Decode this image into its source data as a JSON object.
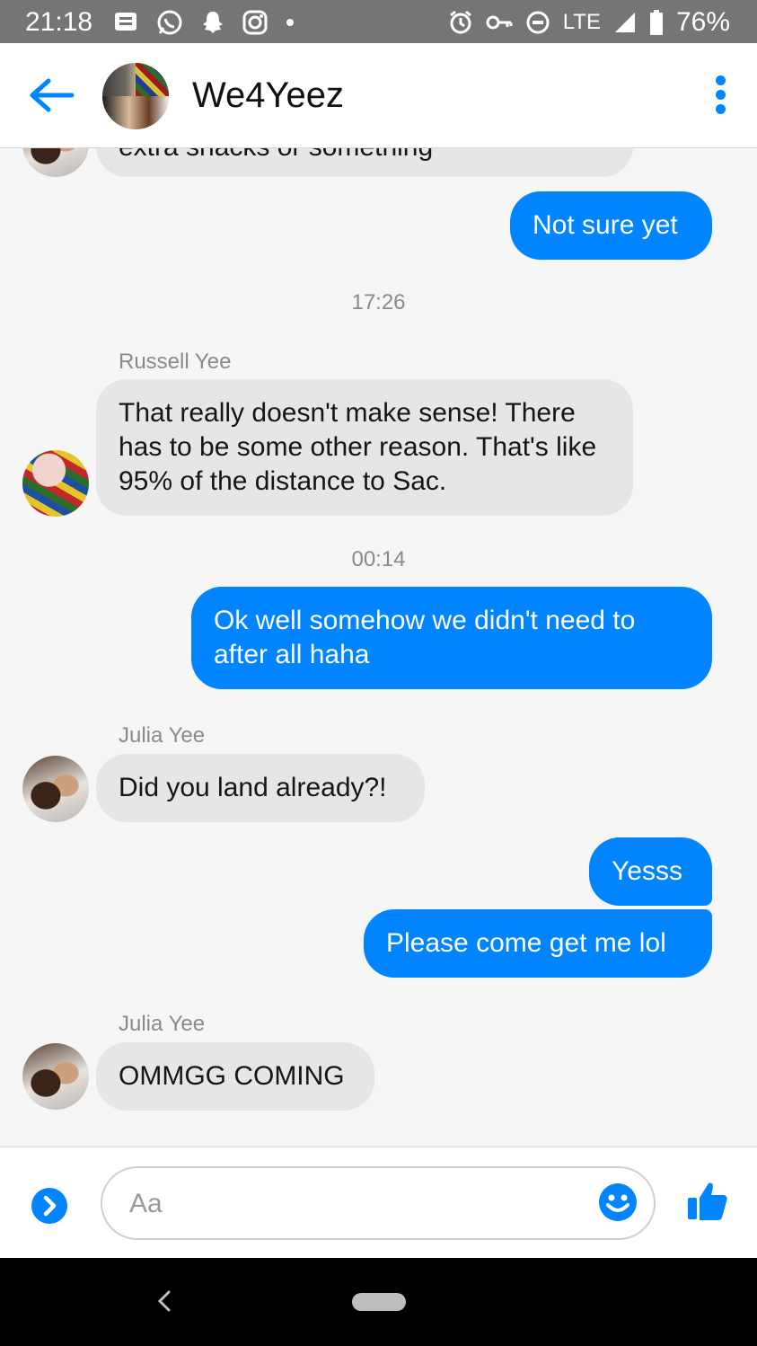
{
  "status_bar": {
    "time": "21:18",
    "network": "LTE",
    "battery": "76%"
  },
  "header": {
    "title": "We4Yeez"
  },
  "thread": {
    "partial_message": "extra snacks or something",
    "messages": [
      {
        "id": "m1",
        "text": "Not sure yet"
      },
      {
        "id": "ts1",
        "text": "17:26"
      },
      {
        "id": "s1",
        "text": "Russell Yee"
      },
      {
        "id": "m2",
        "text": "That really doesn't make sense! There has to be some other reason. That's like 95% of the distance to Sac."
      },
      {
        "id": "ts2",
        "text": "00:14"
      },
      {
        "id": "m3",
        "text": "Ok well somehow we didn't need to after all haha"
      },
      {
        "id": "s2",
        "text": "Julia Yee"
      },
      {
        "id": "m4",
        "text": "Did you land already?!"
      },
      {
        "id": "m5",
        "text": "Yesss"
      },
      {
        "id": "m6",
        "text": "Please come get me lol"
      },
      {
        "id": "s3",
        "text": "Julia Yee"
      },
      {
        "id": "m7",
        "text": "OMMGG COMING"
      }
    ]
  },
  "composer": {
    "placeholder": "Aa"
  },
  "colors": {
    "accent": "#0084ff",
    "incoming_bubble": "#e6e6e6",
    "status_bar": "#757575"
  },
  "icons": [
    "back-arrow-icon",
    "more-vertical-icon",
    "expand-icon",
    "emoji-icon",
    "thumbs-up-icon",
    "nav-back-icon",
    "home-pill-icon"
  ]
}
